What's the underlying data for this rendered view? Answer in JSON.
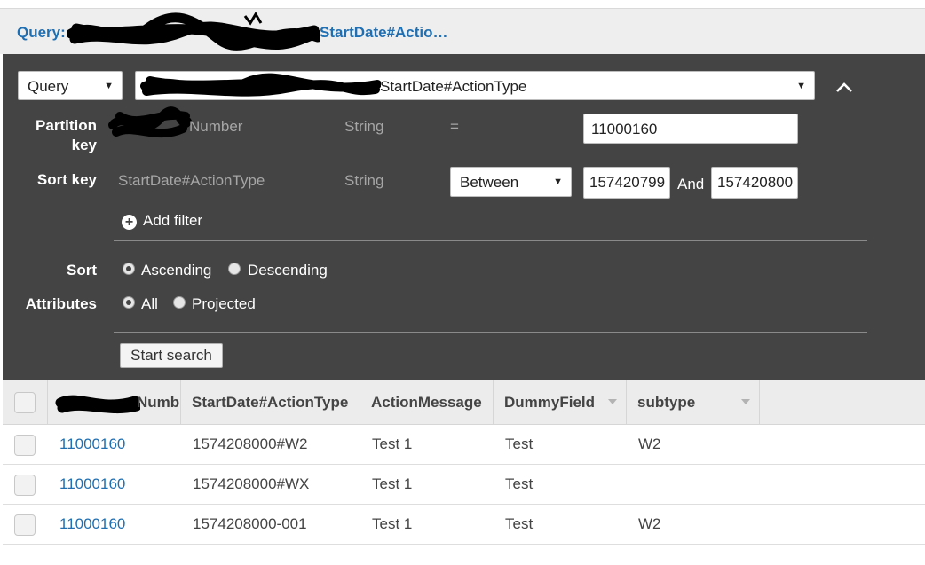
{
  "header": {
    "label": "Query:",
    "title": "StartDate#Actio…"
  },
  "query": {
    "mode_select": "Query",
    "index_select": "StartDate#ActionType",
    "partition_key": {
      "label": "Partition key",
      "name": "Number",
      "type": "String",
      "operator": "=",
      "value": "11000160"
    },
    "sort_key": {
      "label": "Sort key",
      "name": "StartDate#ActionType",
      "type": "String",
      "operator": "Between",
      "value_from": "157420799",
      "and_label": "And",
      "value_to": "157420800"
    },
    "add_filter_label": "Add filter",
    "sort": {
      "label": "Sort",
      "options": [
        "Ascending",
        "Descending"
      ],
      "selected": "Ascending"
    },
    "attributes": {
      "label": "Attributes",
      "options": [
        "All",
        "Projected"
      ],
      "selected": "All"
    },
    "start_search_label": "Start search"
  },
  "table": {
    "columns": [
      "Numb",
      "StartDate#ActionType",
      "ActionMessage",
      "DummyField",
      "subtype"
    ],
    "rows": [
      {
        "number": "11000160",
        "startdate_actiontype": "1574208000#W2",
        "action_message": "Test 1",
        "dummy_field": "Test",
        "subtype": "W2"
      },
      {
        "number": "11000160",
        "startdate_actiontype": "1574208000#WX",
        "action_message": "Test 1",
        "dummy_field": "Test",
        "subtype": ""
      },
      {
        "number": "11000160",
        "startdate_actiontype": "1574208000-001",
        "action_message": "Test 1",
        "dummy_field": "Test",
        "subtype": "W2"
      }
    ]
  },
  "colors": {
    "link": "#1f6fb2",
    "panel_bg": "#444444",
    "header_bg": "#eeeeee"
  }
}
